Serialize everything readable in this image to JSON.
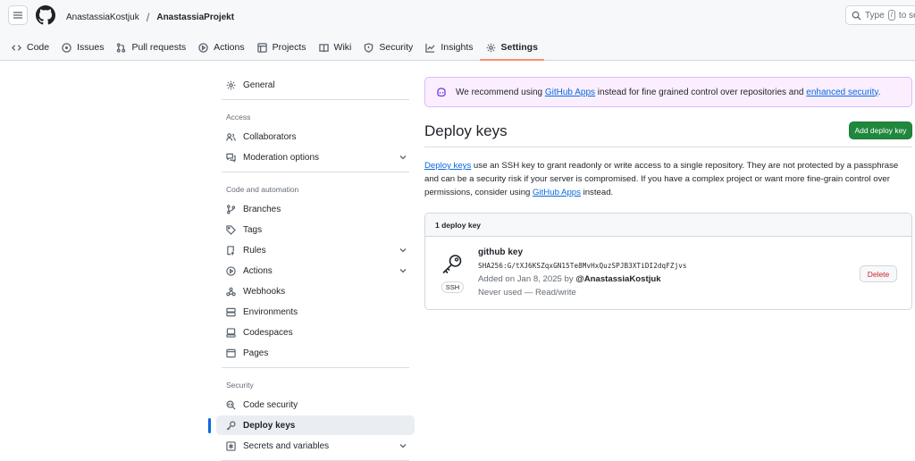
{
  "header": {
    "owner": "AnastassiaKostjuk",
    "separator": "/",
    "repo": "AnastassiaProjekt",
    "search_prefix": "Type",
    "search_key": "/",
    "search_suffix": "to se"
  },
  "tabs": [
    {
      "label": "Code",
      "icon": "code-icon"
    },
    {
      "label": "Issues",
      "icon": "issue-icon"
    },
    {
      "label": "Pull requests",
      "icon": "pull-request-icon"
    },
    {
      "label": "Actions",
      "icon": "play-icon"
    },
    {
      "label": "Projects",
      "icon": "table-icon"
    },
    {
      "label": "Wiki",
      "icon": "book-icon"
    },
    {
      "label": "Security",
      "icon": "shield-icon"
    },
    {
      "label": "Insights",
      "icon": "graph-icon"
    },
    {
      "label": "Settings",
      "icon": "gear-icon",
      "active": true
    }
  ],
  "sidebar": {
    "general": "General",
    "access_heading": "Access",
    "collaborators": "Collaborators",
    "moderation": "Moderation options",
    "code_heading": "Code and automation",
    "branches": "Branches",
    "tags": "Tags",
    "rules": "Rules",
    "actions": "Actions",
    "webhooks": "Webhooks",
    "environments": "Environments",
    "codespaces": "Codespaces",
    "pages": "Pages",
    "security_heading": "Security",
    "code_security": "Code security",
    "deploy_keys": "Deploy keys",
    "secrets": "Secrets and variables"
  },
  "banner": {
    "text_before": "We recommend using ",
    "link1": "GitHub Apps",
    "text_middle": " instead for fine grained control over repositories and ",
    "link2": "enhanced security",
    "text_after": "."
  },
  "main": {
    "title": "Deploy keys",
    "add_button": "Add deploy key",
    "desc_link1": "Deploy keys",
    "desc_text": " use an SSH key to grant readonly or write access to a single repository. They are not protected by a passphrase and can be a security risk if your server is compromised. If you have a complex project or want more fine-grain control over permissions, consider using ",
    "desc_link2": "GitHub Apps",
    "desc_end": " instead.",
    "count_label": "1 deploy key"
  },
  "key": {
    "name": "github key",
    "fingerprint": "SHA256:G/tXJ6KSZqxGN15Te8MvHxQuzSPJB3XTiDI2dqFZjvs",
    "added_prefix": "Added on Jan 8, 2025 by ",
    "added_by": "@AnastassiaKostjuk",
    "usage": "Never used — Read/write",
    "type_badge": "SSH",
    "delete_button": "Delete"
  },
  "colors": {
    "accent": "#0969da",
    "primary_button": "#1f883d",
    "danger": "#d1242f",
    "active_tab_underline": "#fd8c73",
    "banner_bg": "#fbefff"
  }
}
